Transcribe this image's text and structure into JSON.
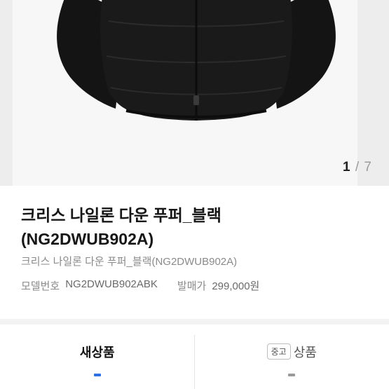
{
  "gallery": {
    "current": "1",
    "separator": "/",
    "total": "7"
  },
  "product": {
    "title_line1": "크리스 나일론 다운 푸퍼_블랙",
    "title_line2": "(NG2DWUB902A)",
    "subtitle": "크리스 나일론 다운 푸퍼_블랙(NG2DWUB902A)",
    "model_label": "모델번호",
    "model_value": "NG2DWUB902ABK",
    "price_label": "발매가",
    "price_value": "299,000원"
  },
  "tabs": {
    "new_label": "새상품",
    "used_badge": "중고",
    "used_label": "상품"
  },
  "colors": {
    "accent": "#2f6fe4",
    "jacket": "#161616"
  }
}
